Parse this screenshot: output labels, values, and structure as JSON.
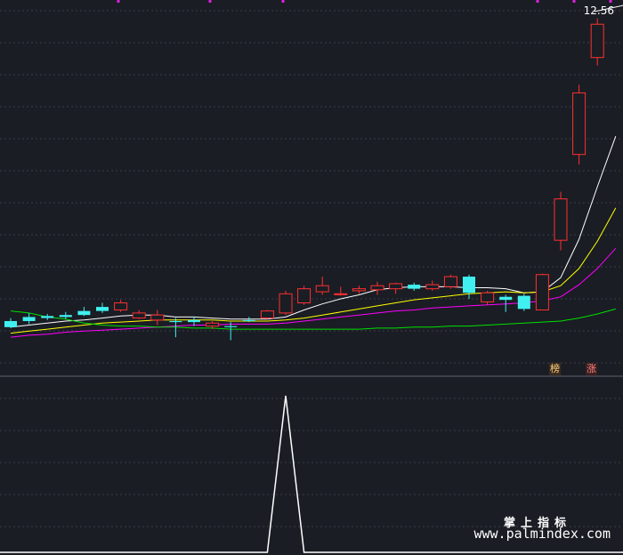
{
  "chart_data": [
    {
      "type": "candlestick",
      "price_max_label": "12.56",
      "marker_labels": [
        "榜",
        "涨"
      ],
      "candles": [
        {
          "o": 9.52,
          "c": 9.46,
          "h": 9.55,
          "l": 9.45
        },
        {
          "o": 9.56,
          "c": 9.52,
          "h": 9.6,
          "l": 9.49
        },
        {
          "o": 9.57,
          "c": 9.55,
          "h": 9.59,
          "l": 9.53
        },
        {
          "o": 9.58,
          "c": 9.56,
          "h": 9.61,
          "l": 9.54
        },
        {
          "o": 9.62,
          "c": 9.58,
          "h": 9.66,
          "l": 9.57
        },
        {
          "o": 9.66,
          "c": 9.62,
          "h": 9.7,
          "l": 9.6
        },
        {
          "o": 9.63,
          "c": 9.7,
          "h": 9.73,
          "l": 9.61
        },
        {
          "o": 9.55,
          "c": 9.6,
          "h": 9.63,
          "l": 9.54
        },
        {
          "o": 9.53,
          "c": 9.58,
          "h": 9.63,
          "l": 9.48
        },
        {
          "o": 9.52,
          "c": 9.51,
          "h": 9.55,
          "l": 9.36
        },
        {
          "o": 9.53,
          "c": 9.51,
          "h": 9.56,
          "l": 9.47
        },
        {
          "o": 9.47,
          "c": 9.5,
          "h": 9.52,
          "l": 9.44
        },
        {
          "o": 9.47,
          "c": 9.46,
          "h": 9.51,
          "l": 9.33
        },
        {
          "o": 9.53,
          "c": 9.52,
          "h": 9.56,
          "l": 9.51
        },
        {
          "o": 9.55,
          "c": 9.62,
          "h": 9.63,
          "l": 9.54
        },
        {
          "o": 9.6,
          "c": 9.79,
          "h": 9.82,
          "l": 9.58
        },
        {
          "o": 9.7,
          "c": 9.84,
          "h": 9.87,
          "l": 9.68
        },
        {
          "o": 9.81,
          "c": 9.87,
          "h": 9.96,
          "l": 9.78
        },
        {
          "o": 9.79,
          "c": 9.79,
          "h": 9.86,
          "l": 9.77
        },
        {
          "o": 9.82,
          "c": 9.84,
          "h": 9.87,
          "l": 9.79
        },
        {
          "o": 9.83,
          "c": 9.87,
          "h": 9.91,
          "l": 9.78
        },
        {
          "o": 9.84,
          "c": 9.89,
          "h": 9.9,
          "l": 9.79
        },
        {
          "o": 9.88,
          "c": 9.84,
          "h": 9.9,
          "l": 9.82
        },
        {
          "o": 9.84,
          "c": 9.88,
          "h": 9.92,
          "l": 9.82
        },
        {
          "o": 9.86,
          "c": 9.96,
          "h": 9.98,
          "l": 9.84
        },
        {
          "o": 9.96,
          "c": 9.8,
          "h": 9.98,
          "l": 9.74
        },
        {
          "o": 9.71,
          "c": 9.8,
          "h": 9.82,
          "l": 9.68
        },
        {
          "o": 9.76,
          "c": 9.73,
          "h": 9.78,
          "l": 9.61
        },
        {
          "o": 9.77,
          "c": 9.64,
          "h": 9.79,
          "l": 9.62
        },
        {
          "o": 9.63,
          "c": 9.98,
          "h": 9.99,
          "l": 9.63
        },
        {
          "o": 10.32,
          "c": 10.73,
          "h": 10.8,
          "l": 10.22
        },
        {
          "o": 11.17,
          "c": 11.78,
          "h": 11.86,
          "l": 11.07
        },
        {
          "o": 12.13,
          "c": 12.46,
          "h": 12.52,
          "l": 12.05
        }
      ],
      "ma": [
        {
          "name": "MA-white",
          "color": "#ffffff",
          "values": [
            9.46,
            9.48,
            9.5,
            9.52,
            9.53,
            9.55,
            9.57,
            9.58,
            9.58,
            9.56,
            9.56,
            9.55,
            9.54,
            9.54,
            9.54,
            9.56,
            9.63,
            9.69,
            9.74,
            9.78,
            9.83,
            9.85,
            9.86,
            9.86,
            9.86,
            9.85,
            9.85,
            9.84,
            9.8,
            9.81,
            9.95,
            10.33,
            10.85,
            11.35
          ]
        },
        {
          "name": "MA-yellow",
          "color": "#ffff00",
          "values": [
            9.4,
            9.42,
            9.44,
            9.46,
            9.48,
            9.5,
            9.51,
            9.52,
            9.53,
            9.53,
            9.53,
            9.53,
            9.52,
            9.52,
            9.52,
            9.53,
            9.55,
            9.58,
            9.61,
            9.64,
            9.67,
            9.7,
            9.73,
            9.75,
            9.77,
            9.79,
            9.8,
            9.81,
            9.8,
            9.81,
            9.87,
            10.04,
            10.31,
            10.64
          ]
        },
        {
          "name": "MA-magenta",
          "color": "#ff00ff",
          "values": [
            9.36,
            9.38,
            9.39,
            9.41,
            9.42,
            9.43,
            9.44,
            9.45,
            9.46,
            9.47,
            9.48,
            9.48,
            9.49,
            9.49,
            9.49,
            9.5,
            9.52,
            9.54,
            9.56,
            9.58,
            9.6,
            9.62,
            9.63,
            9.65,
            9.66,
            9.67,
            9.68,
            9.69,
            9.7,
            9.72,
            9.76,
            9.88,
            10.04,
            10.24
          ]
        },
        {
          "name": "MA-green",
          "color": "#00e000",
          "values": [
            9.62,
            9.6,
            9.56,
            9.54,
            9.5,
            9.48,
            9.47,
            9.47,
            9.46,
            9.46,
            9.45,
            9.45,
            9.44,
            9.44,
            9.44,
            9.44,
            9.44,
            9.44,
            9.44,
            9.44,
            9.45,
            9.45,
            9.46,
            9.46,
            9.47,
            9.47,
            9.48,
            9.49,
            9.5,
            9.51,
            9.52,
            9.55,
            9.59,
            9.64
          ]
        }
      ],
      "ylim": [
        9.0,
        12.7
      ],
      "grid": true
    },
    {
      "type": "line",
      "series": [
        {
          "color": "#ffffff",
          "values": [
            0,
            0,
            0,
            0,
            0,
            0,
            0,
            0,
            0,
            0,
            0,
            0,
            0,
            0,
            0,
            1,
            0,
            0,
            0,
            0,
            0,
            0,
            0,
            0,
            0,
            0,
            0,
            0,
            0,
            0,
            0,
            0,
            0,
            0
          ]
        }
      ],
      "ylim": [
        0,
        1
      ],
      "grid": true
    }
  ],
  "watermark": {
    "cn": "掌上指标",
    "url": "www.palmindex.com"
  },
  "colors": {
    "background": "#1a1d24",
    "up": "#ff3030",
    "down": "#40f0f0",
    "grid": "#3a3d48"
  }
}
